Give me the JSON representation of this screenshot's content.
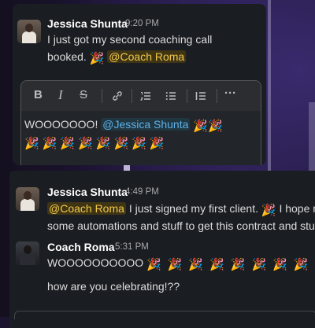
{
  "top_message": {
    "author": "Jessica Shunta",
    "time": "9:20 PM",
    "line1": "I just got my second coaching call",
    "line2_prefix": "booked.",
    "mention": "@Coach Roma",
    "emoji": "🎉"
  },
  "composer": {
    "toolbar": {
      "bold": "B",
      "italic": "I",
      "strike": "S",
      "link": "🔗",
      "ordered_list": "☰",
      "bullet_list": "☰",
      "blockquote": "☰",
      "more": "···"
    },
    "text_prefix": "WOOOOOOO!",
    "mention": "@Jessica Shunta",
    "emoji": "🎉"
  },
  "messages": [
    {
      "author": "Jessica Shunta",
      "time": "4:49 PM",
      "mention": "@Coach Roma",
      "line1": "I just signed my first client.",
      "line1_tail": "I hope m",
      "line2": "some automations and stuff to get this contract and stu",
      "emoji": "🎉"
    },
    {
      "author": "Coach Roma",
      "time": "5:31 PM",
      "line1": "WOOOOOOOOOO",
      "line2": "how are you celebrating!??",
      "emoji": "🎉"
    }
  ],
  "colors": {
    "panel": "#1a1d21",
    "mention_bg": "#3f3514",
    "mention_fg": "#f1c84b",
    "mention_blue": "#5fb1e8"
  }
}
